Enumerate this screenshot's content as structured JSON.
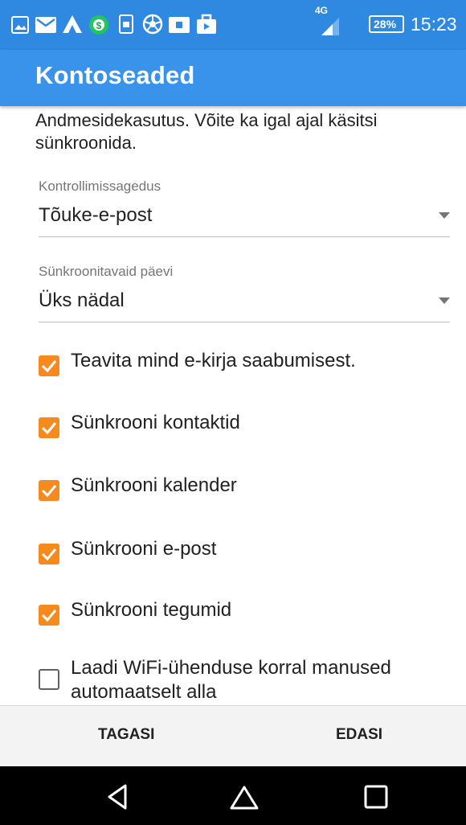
{
  "status_bar": {
    "network": "4G",
    "battery": "28%",
    "time": "15:23"
  },
  "app_bar": {
    "title": "Kontoseaded"
  },
  "description": {
    "text": "Andmesidekasutus. Võite ka igal ajal käsitsi sünkroonida."
  },
  "check_frequency": {
    "label": "Kontrollimissagedus",
    "value": "Tõuke-e-post"
  },
  "sync_days": {
    "label": "Sünkroonitavaid päevi",
    "value": "Üks nädal"
  },
  "checkboxes": [
    {
      "label": "Teavita mind e-kirja saabumisest.",
      "checked": true
    },
    {
      "label": "Sünkrooni kontaktid",
      "checked": true
    },
    {
      "label": "Sünkrooni kalender",
      "checked": true
    },
    {
      "label": "Sünkrooni e-post",
      "checked": true
    },
    {
      "label": "Sünkrooni tegumid",
      "checked": true
    },
    {
      "label": "Laadi WiFi-ühenduse korral manused automaatselt alla",
      "checked": false
    }
  ],
  "footer_buttons": {
    "back": "TAGASI",
    "next": "EDASI"
  },
  "colors": {
    "status_bar": "#2f89e0",
    "app_bar": "#3993ea",
    "checkbox_accent": "#f68a1e"
  },
  "icons": [
    "gallery-icon",
    "mail-icon",
    "triangle-app-icon",
    "dollar-app-icon",
    "sim-icon",
    "soccer-icon",
    "keyboard-icon",
    "briefcase-icon",
    "signal-icon",
    "battery-icon",
    "back-icon",
    "home-icon",
    "recents-icon"
  ]
}
